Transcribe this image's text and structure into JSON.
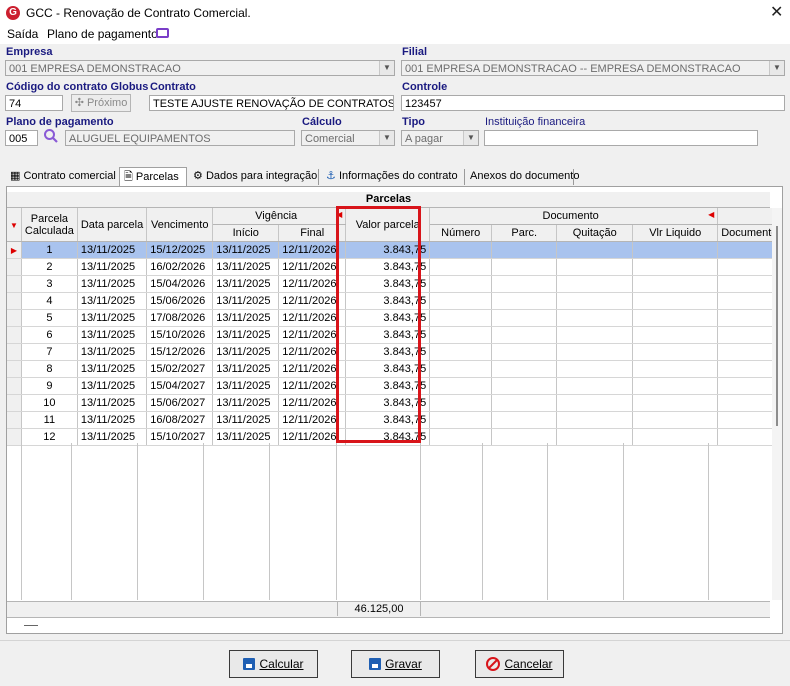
{
  "window": {
    "title": "GCC - Renovação de Contrato Comercial.",
    "app_icon_letter": "G"
  },
  "menu": {
    "items": [
      "Saída",
      "Plano de pagamento"
    ]
  },
  "form": {
    "empresa_label": "Empresa",
    "empresa_value": "001 EMPRESA DEMONSTRACAO",
    "filial_label": "Filial",
    "filial_value": "001 EMPRESA DEMONSTRACAO -- EMPRESA DEMONSTRACAO",
    "codigo_label": "Código do contrato Globus",
    "codigo_value": "74",
    "proximo_label": "Próximo",
    "contrato_label": "Contrato",
    "contrato_value": "TESTE AJUSTE RENOVAÇÃO DE CONTRATOS",
    "controle_label": "Controle",
    "controle_value": "123457",
    "plano_label": "Plano de pagamento",
    "plano_code": "005",
    "plano_name": "ALUGUEL EQUIPAMENTOS",
    "calculo_label": "Cálculo",
    "calculo_value": "Comercial",
    "tipo_label": "Tipo",
    "tipo_value": "A pagar",
    "instituicao_label": "Instituição financeira",
    "instituicao_value": ""
  },
  "tabs": [
    "Contrato comercial",
    "Parcelas",
    "Dados para integração",
    "Informações do contrato",
    "Anexos do documento"
  ],
  "active_tab": "Parcelas",
  "grid": {
    "caption": "Parcelas",
    "headers": {
      "parcela": "Parcela Calculada",
      "data": "Data parcela",
      "vencimento": "Vencimento",
      "vigencia": "Vigência",
      "inicio": "Início",
      "final": "Final",
      "valor": "Valor parcela",
      "documento": "Documento",
      "numero": "Número",
      "parc": "Parc.",
      "quitacao": "Quitação",
      "vlr_liquido": "Vlr Liquido",
      "documento2": "Documento"
    },
    "rows": [
      {
        "p": "1",
        "data": "13/11/2025",
        "venc": "15/12/2025",
        "ini": "13/11/2025",
        "fim": "12/11/2026",
        "valor": "3.843,75"
      },
      {
        "p": "2",
        "data": "13/11/2025",
        "venc": "16/02/2026",
        "ini": "13/11/2025",
        "fim": "12/11/2026",
        "valor": "3.843,75"
      },
      {
        "p": "3",
        "data": "13/11/2025",
        "venc": "15/04/2026",
        "ini": "13/11/2025",
        "fim": "12/11/2026",
        "valor": "3.843,75"
      },
      {
        "p": "4",
        "data": "13/11/2025",
        "venc": "15/06/2026",
        "ini": "13/11/2025",
        "fim": "12/11/2026",
        "valor": "3.843,75"
      },
      {
        "p": "5",
        "data": "13/11/2025",
        "venc": "17/08/2026",
        "ini": "13/11/2025",
        "fim": "12/11/2026",
        "valor": "3.843,75"
      },
      {
        "p": "6",
        "data": "13/11/2025",
        "venc": "15/10/2026",
        "ini": "13/11/2025",
        "fim": "12/11/2026",
        "valor": "3.843,75"
      },
      {
        "p": "7",
        "data": "13/11/2025",
        "venc": "15/12/2026",
        "ini": "13/11/2025",
        "fim": "12/11/2026",
        "valor": "3.843,75"
      },
      {
        "p": "8",
        "data": "13/11/2025",
        "venc": "15/02/2027",
        "ini": "13/11/2025",
        "fim": "12/11/2026",
        "valor": "3.843,75"
      },
      {
        "p": "9",
        "data": "13/11/2025",
        "venc": "15/04/2027",
        "ini": "13/11/2025",
        "fim": "12/11/2026",
        "valor": "3.843,75"
      },
      {
        "p": "10",
        "data": "13/11/2025",
        "venc": "15/06/2027",
        "ini": "13/11/2025",
        "fim": "12/11/2026",
        "valor": "3.843,75"
      },
      {
        "p": "11",
        "data": "13/11/2025",
        "venc": "16/08/2027",
        "ini": "13/11/2025",
        "fim": "12/11/2026",
        "valor": "3.843,75"
      },
      {
        "p": "12",
        "data": "13/11/2025",
        "venc": "15/10/2027",
        "ini": "13/11/2025",
        "fim": "12/11/2026",
        "valor": "3.843,75"
      }
    ],
    "total": "46.125,00"
  },
  "buttons": {
    "calcular": "Calcular",
    "gravar": "Gravar",
    "cancelar": "Cancelar"
  },
  "colors": {
    "highlight": "#d8141a",
    "selected_row": "#a9c3ee",
    "label": "#1a1a80"
  }
}
